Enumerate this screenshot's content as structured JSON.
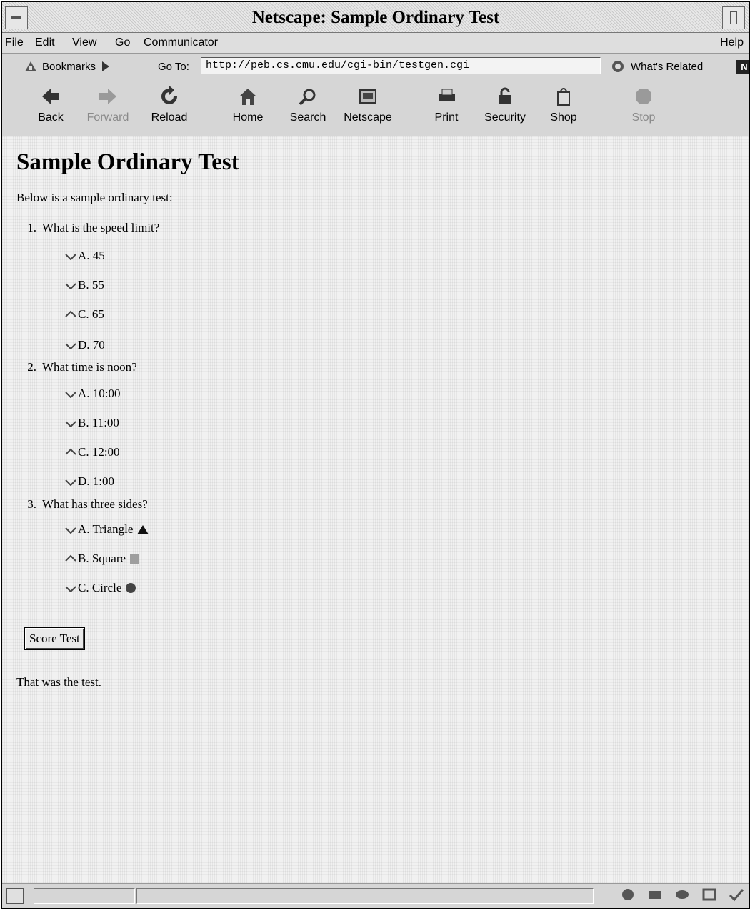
{
  "window": {
    "title": "Netscape: Sample Ordinary Test"
  },
  "menubar": {
    "items": [
      "File",
      "Edit",
      "View",
      "Go",
      "Communicator"
    ],
    "help": "Help"
  },
  "locationbar": {
    "bookmarks_label": "Bookmarks",
    "goto_label": "Go To:",
    "url": "http://peb.cs.cmu.edu/cgi-bin/testgen.cgi",
    "related_label": "What's Related"
  },
  "toolbar": {
    "buttons": [
      {
        "label": "Back",
        "icon": "back-arrow-icon",
        "enabled": true
      },
      {
        "label": "Forward",
        "icon": "forward-arrow-icon",
        "enabled": false
      },
      {
        "label": "Reload",
        "icon": "reload-icon",
        "enabled": true
      },
      {
        "label": "Home",
        "icon": "home-icon",
        "enabled": true
      },
      {
        "label": "Search",
        "icon": "search-icon",
        "enabled": true
      },
      {
        "label": "Netscape",
        "icon": "my-netscape-icon",
        "enabled": true
      },
      {
        "label": "Print",
        "icon": "printer-icon",
        "enabled": true
      },
      {
        "label": "Security",
        "icon": "lock-icon",
        "enabled": true
      },
      {
        "label": "Shop",
        "icon": "shopping-bag-icon",
        "enabled": true
      },
      {
        "label": "Stop",
        "icon": "stop-icon",
        "enabled": false
      }
    ]
  },
  "page": {
    "title": "Sample Ordinary Test",
    "intro": "Below is a sample ordinary test:",
    "questions": [
      {
        "number": "1.",
        "text": "What is the speed limit?",
        "options": [
          {
            "label": "A. 45",
            "selected": false
          },
          {
            "label": "B. 55",
            "selected": false
          },
          {
            "label": "C. 65",
            "selected": true
          },
          {
            "label": "D. 70",
            "selected": false
          }
        ]
      },
      {
        "number": "2.",
        "text_before": "What ",
        "text_link": "time",
        "text_after": " is noon?",
        "options": [
          {
            "label": "A. 10:00",
            "selected": false
          },
          {
            "label": "B. 11:00",
            "selected": false
          },
          {
            "label": "C. 12:00",
            "selected": true
          },
          {
            "label": "D. 1:00",
            "selected": false
          }
        ]
      },
      {
        "number": "3.",
        "text": "What has three sides?",
        "options": [
          {
            "label": "A. Triangle",
            "selected": false,
            "shape": "triangle"
          },
          {
            "label": "B. Square",
            "selected": true,
            "shape": "square"
          },
          {
            "label": "C. Circle",
            "selected": false,
            "shape": "circle"
          }
        ]
      }
    ],
    "score_button": "Score Test",
    "outro": "That was the test."
  }
}
